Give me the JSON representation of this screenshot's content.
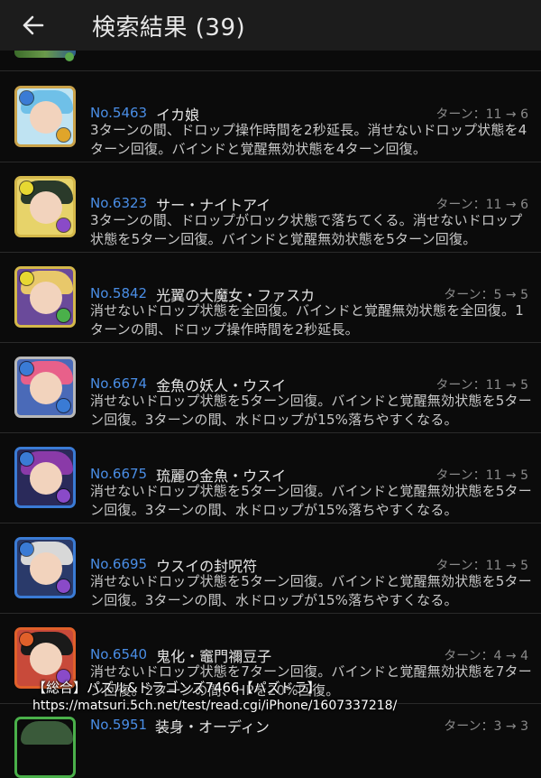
{
  "header": {
    "back_icon": "arrow-left-icon",
    "title": "検索結果 (39)"
  },
  "results": [
    {
      "no": "No.5463",
      "name": "イカ娘",
      "turn": "ターン：11 → 6",
      "desc": "3ターンの間、ドロップ操作時間を2秒延長。消せないドロップ状態を4ターン回復。バインドと覚醒無効状態を4ターン回復。",
      "border": "#c9a24a",
      "hair": "#6fc0e8",
      "bg": "#bfe3f2",
      "orb1": "#3a7bd5",
      "orb2": "#e0a52a"
    },
    {
      "no": "No.6323",
      "name": "サー・ナイトアイ",
      "turn": "ターン：11 → 6",
      "desc": "3ターンの間、ドロップがロック状態で落ちてくる。消せないドロップ状態を5ターン回復。バインドと覚醒無効状態を5ターン回復。",
      "border": "#d4b84a",
      "hair": "#2a3a2a",
      "bg": "#e7d36a",
      "orb1": "#e7d832",
      "orb2": "#8a4ac8"
    },
    {
      "no": "No.5842",
      "name": "光翼の大魔女・ファスカ",
      "turn": "ターン：5 → 5",
      "desc": "消せないドロップ状態を全回復。バインドと覚醒無効状態を全回復。1ターンの間、ドロップ操作時間を2秒延長。",
      "border": "#d4b84a",
      "hair": "#e8c86a",
      "bg": "#6a4a9a",
      "orb1": "#e7d832",
      "orb2": "#4ab04a"
    },
    {
      "no": "No.6674",
      "name": "金魚の妖人・ウスイ",
      "turn": "ターン：11 → 5",
      "desc": "消せないドロップ状態を5ターン回復。バインドと覚醒無効状態を5ターン回復。3ターンの間、水ドロップが15%落ちやすくなる。",
      "border": "#b8b8b8",
      "hair": "#e8608a",
      "bg": "#4a6ab8",
      "orb1": "#3a7bd5",
      "orb2": "#3a7bd5"
    },
    {
      "no": "No.6675",
      "name": "琉麗の金魚・ウスイ",
      "turn": "ターン：11 → 5",
      "desc": "消せないドロップ状態を5ターン回復。バインドと覚醒無効状態を5ターン回復。3ターンの間、水ドロップが15%落ちやすくなる。",
      "border": "#3a7bd5",
      "hair": "#8a3aa8",
      "bg": "#2a2a5a",
      "orb1": "#3a7bd5",
      "orb2": "#8a4ac8"
    },
    {
      "no": "No.6695",
      "name": "ウスイの封呪符",
      "turn": "ターン：11 → 5",
      "desc": "消せないドロップ状態を5ターン回復。バインドと覚醒無効状態を5ターン回復。3ターンの間、水ドロップが15%落ちやすくなる。",
      "border": "#3a7bd5",
      "hair": "#d8d8d8",
      "bg": "#2a3a6a",
      "orb1": "#3a7bd5",
      "orb2": "#8a4ac8"
    },
    {
      "no": "No.6540",
      "name": "鬼化・竈門禰豆子",
      "turn": "ターン：4 → 4",
      "desc": "消せないドロップ状態を7ターン回復。バインドと覚醒無効状態を7ターン回復。2ターンの間、HPを20%回復。",
      "border": "#e0602a",
      "hair": "#1a1a1a",
      "bg": "#c84a3a",
      "orb1": "#e0602a",
      "orb2": "#8a4ac8"
    }
  ],
  "partial_bottom": {
    "no": "No.5951",
    "name": "装身・オーディン",
    "turn": "ターン：3 → 3"
  },
  "watermark": {
    "line1": "【総合】パズル&ドラゴンズ7466【パズドラ】",
    "line2": "https://matsuri.5ch.net/test/read.cgi/iPhone/1607337218/"
  }
}
